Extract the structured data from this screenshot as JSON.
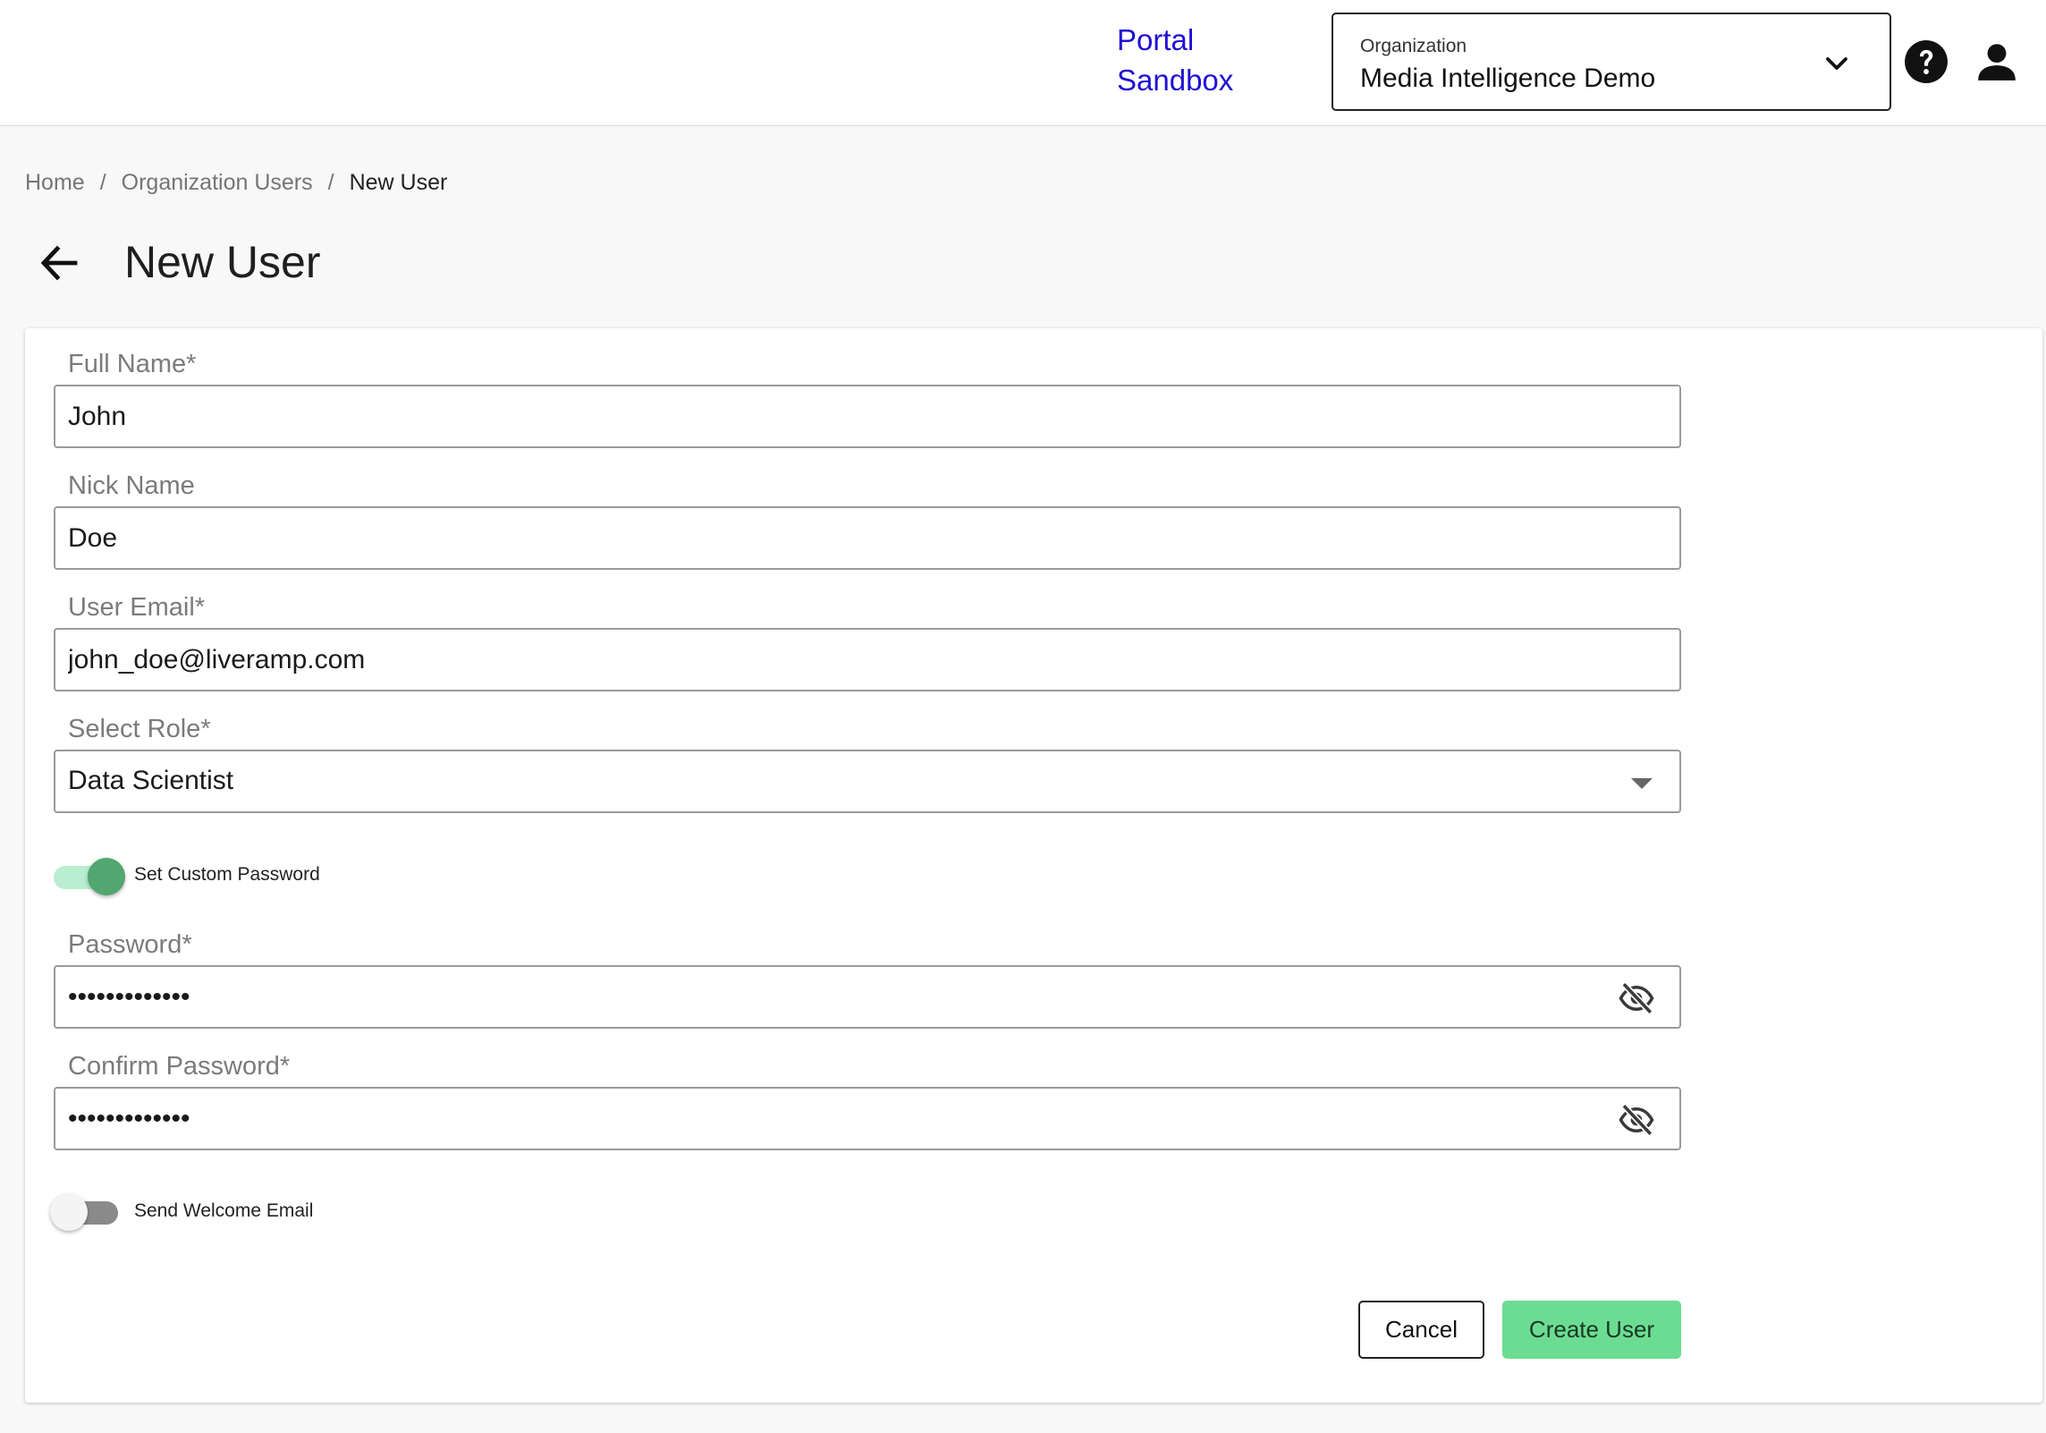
{
  "header": {
    "env_link_line1": "Portal",
    "env_link_line2": "Sandbox",
    "organization": {
      "label": "Organization",
      "value": "Media Intelligence Demo"
    },
    "icons": [
      "help-icon",
      "account-icon",
      "chevron-down-icon"
    ],
    "link_color": "#1f0ed6"
  },
  "breadcrumb": {
    "items": [
      "Home",
      "Organization Users",
      "New User"
    ],
    "separator": "/"
  },
  "page": {
    "title": "New User"
  },
  "form": {
    "full_name": {
      "label": "Full Name",
      "required_mark": "*",
      "value": "John"
    },
    "nick_name": {
      "label": "Nick Name",
      "value": "Doe"
    },
    "user_email": {
      "label": "User Email",
      "required_mark": "*",
      "value": "john_doe@liveramp.com"
    },
    "role": {
      "label": "Select Role",
      "required_mark": "*",
      "value": "Data Scientist"
    },
    "custom_password_toggle": {
      "label": "Set Custom Password",
      "on": true
    },
    "password": {
      "label": "Password",
      "required_mark": "*",
      "value": "passwordvalue"
    },
    "confirm_password": {
      "label": "Confirm Password",
      "required_mark": "*",
      "value": "passwordvalue"
    },
    "welcome_email_toggle": {
      "label": "Send Welcome Email",
      "on": false
    }
  },
  "actions": {
    "cancel_label": "Cancel",
    "create_label": "Create User",
    "primary_color": "#6ddc93"
  }
}
